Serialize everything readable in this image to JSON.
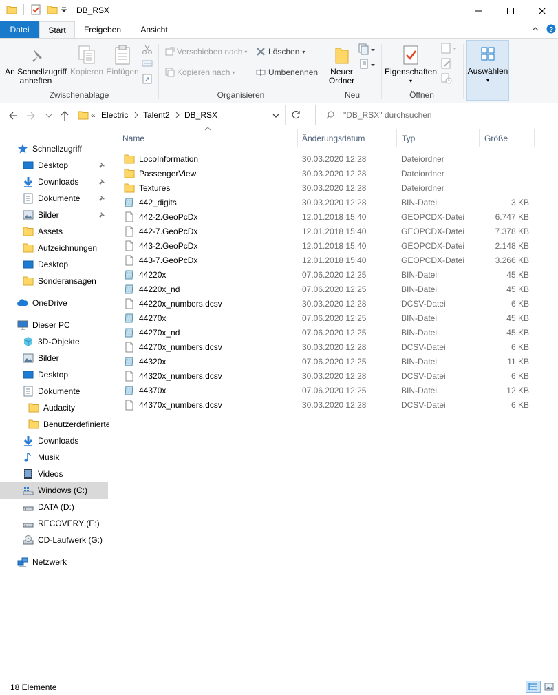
{
  "window": {
    "title": "DB_RSX"
  },
  "ribbon_tabs": [
    "Datei",
    "Start",
    "Freigeben",
    "Ansicht"
  ],
  "ribbon": {
    "clipboard": {
      "pin_label_1": "An Schnellzugriff",
      "pin_label_2": "anheften",
      "copy_label": "Kopieren",
      "paste_label": "Einfügen",
      "group_label": "Zwischenablage"
    },
    "organize": {
      "move_label": "Verschieben nach",
      "copy_to_label": "Kopieren nach",
      "delete_label": "Löschen",
      "rename_label": "Umbenennen",
      "group_label": "Organisieren"
    },
    "new": {
      "new_folder_1": "Neuer",
      "new_folder_2": "Ordner",
      "group_label": "Neu"
    },
    "open": {
      "properties_label": "Eigenschaften",
      "group_label": "Öffnen"
    },
    "select": {
      "select_label": "Auswählen"
    }
  },
  "navigation": {
    "breadcrumb": [
      "Electric",
      "Talent2",
      "DB_RSX"
    ],
    "overflow": "«",
    "search_placeholder": "\"DB_RSX\" durchsuchen"
  },
  "sidebar": {
    "quick_access": "Schnellzugriff",
    "quick_items": [
      "Desktop",
      "Downloads",
      "Dokumente",
      "Bilder",
      "Assets",
      "Aufzeichnungen",
      "Desktop",
      "Sonderansagen"
    ],
    "onedrive": "OneDrive",
    "this_pc": "Dieser PC",
    "pc_items": [
      "3D-Objekte",
      "Bilder",
      "Desktop",
      "Dokumente",
      "Audacity",
      "Benutzerdefinierte",
      "Downloads",
      "Musik",
      "Videos",
      "Windows (C:)",
      "DATA (D:)",
      "RECOVERY (E:)",
      "CD-Laufwerk (G:)"
    ],
    "network": "Netzwerk"
  },
  "columns": {
    "name": "Name",
    "date": "Änderungsdatum",
    "type": "Typ",
    "size": "Größe"
  },
  "files": [
    {
      "name": "LocoInformation",
      "date": "30.03.2020 12:28",
      "type": "Dateiordner",
      "size": "",
      "icon": "folder-icon"
    },
    {
      "name": "PassengerView",
      "date": "30.03.2020 12:28",
      "type": "Dateiordner",
      "size": "",
      "icon": "folder-icon"
    },
    {
      "name": "Textures",
      "date": "30.03.2020 12:28",
      "type": "Dateiordner",
      "size": "",
      "icon": "folder-icon"
    },
    {
      "name": "442_digits",
      "date": "30.03.2020 12:28",
      "type": "BIN-Datei",
      "size": "3 KB",
      "icon": "bin-file-icon"
    },
    {
      "name": "442-2.GeoPcDx",
      "date": "12.01.2018 15:40",
      "type": "GEOPCDX-Datei",
      "size": "6.747 KB",
      "icon": "file-icon"
    },
    {
      "name": "442-7.GeoPcDx",
      "date": "12.01.2018 15:40",
      "type": "GEOPCDX-Datei",
      "size": "7.378 KB",
      "icon": "file-icon"
    },
    {
      "name": "443-2.GeoPcDx",
      "date": "12.01.2018 15:40",
      "type": "GEOPCDX-Datei",
      "size": "2.148 KB",
      "icon": "file-icon"
    },
    {
      "name": "443-7.GeoPcDx",
      "date": "12.01.2018 15:40",
      "type": "GEOPCDX-Datei",
      "size": "3.266 KB",
      "icon": "file-icon"
    },
    {
      "name": "44220x",
      "date": "07.06.2020 12:25",
      "type": "BIN-Datei",
      "size": "45 KB",
      "icon": "bin-file-icon"
    },
    {
      "name": "44220x_nd",
      "date": "07.06.2020 12:25",
      "type": "BIN-Datei",
      "size": "45 KB",
      "icon": "bin-file-icon"
    },
    {
      "name": "44220x_numbers.dcsv",
      "date": "30.03.2020 12:28",
      "type": "DCSV-Datei",
      "size": "6 KB",
      "icon": "file-icon"
    },
    {
      "name": "44270x",
      "date": "07.06.2020 12:25",
      "type": "BIN-Datei",
      "size": "45 KB",
      "icon": "bin-file-icon"
    },
    {
      "name": "44270x_nd",
      "date": "07.06.2020 12:25",
      "type": "BIN-Datei",
      "size": "45 KB",
      "icon": "bin-file-icon"
    },
    {
      "name": "44270x_numbers.dcsv",
      "date": "30.03.2020 12:28",
      "type": "DCSV-Datei",
      "size": "6 KB",
      "icon": "file-icon"
    },
    {
      "name": "44320x",
      "date": "07.06.2020 12:25",
      "type": "BIN-Datei",
      "size": "11 KB",
      "icon": "bin-file-icon"
    },
    {
      "name": "44320x_numbers.dcsv",
      "date": "30.03.2020 12:28",
      "type": "DCSV-Datei",
      "size": "6 KB",
      "icon": "file-icon"
    },
    {
      "name": "44370x",
      "date": "07.06.2020 12:25",
      "type": "BIN-Datei",
      "size": "12 KB",
      "icon": "bin-file-icon"
    },
    {
      "name": "44370x_numbers.dcsv",
      "date": "30.03.2020 12:28",
      "type": "DCSV-Datei",
      "size": "6 KB",
      "icon": "file-icon"
    }
  ],
  "status": {
    "count": "18 Elemente"
  },
  "colors": {
    "accent": "#1979ca",
    "folder": "#ffd766",
    "selected": "#d9d9d9"
  }
}
